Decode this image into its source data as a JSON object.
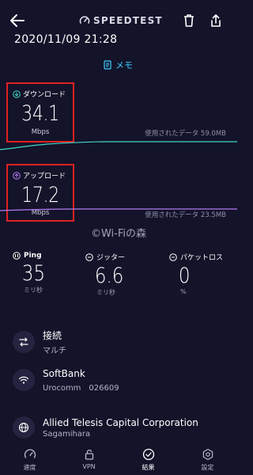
{
  "header": {
    "brand": "SPEEDTEST",
    "datetime": "2020/11/09 21:28",
    "memo_label": "メモ"
  },
  "download": {
    "label": "ダウンロード",
    "value": "34.1",
    "unit": "Mbps",
    "data_used": "使用されたデータ 59.0MB"
  },
  "upload": {
    "label": "アップロード",
    "value": "17.2",
    "unit": "Mbps",
    "data_used": "使用されたデータ 23.5MB"
  },
  "watermark": "©Wi-Fiの森",
  "metrics": {
    "ping": {
      "label": "Ping",
      "value": "35",
      "unit": "ミリ秒"
    },
    "jitter": {
      "label": "ジッター",
      "value": "6.6",
      "unit": "ミリ秒"
    },
    "loss": {
      "label": "パケットロス",
      "value": "0",
      "unit": "%"
    }
  },
  "info": {
    "connection": {
      "title": "接続",
      "sub": "マルチ"
    },
    "isp": {
      "title": "SoftBank",
      "sub": "Urocomm　026609"
    },
    "server": {
      "title": "Allied Telesis Capital Corporation",
      "sub": "Sagamihara"
    }
  },
  "nav": {
    "speed": "速度",
    "vpn": "VPN",
    "results": "結果",
    "settings": "設定"
  },
  "colors": {
    "background": "#13132a",
    "download_accent": "#3fd7c4",
    "upload_accent": "#b57cf2",
    "highlight_box": "#e02020",
    "memo": "#3fd0ff"
  },
  "icons": [
    "back-arrow-icon",
    "speedtest-logo-icon",
    "trash-icon",
    "share-icon",
    "memo-icon",
    "download-icon",
    "upload-icon",
    "ping-icon",
    "jitter-icon",
    "packet-loss-icon",
    "connection-icon",
    "wifi-icon",
    "globe-icon",
    "speed-icon",
    "vpn-lock-icon",
    "results-check-icon",
    "settings-gear-icon"
  ]
}
